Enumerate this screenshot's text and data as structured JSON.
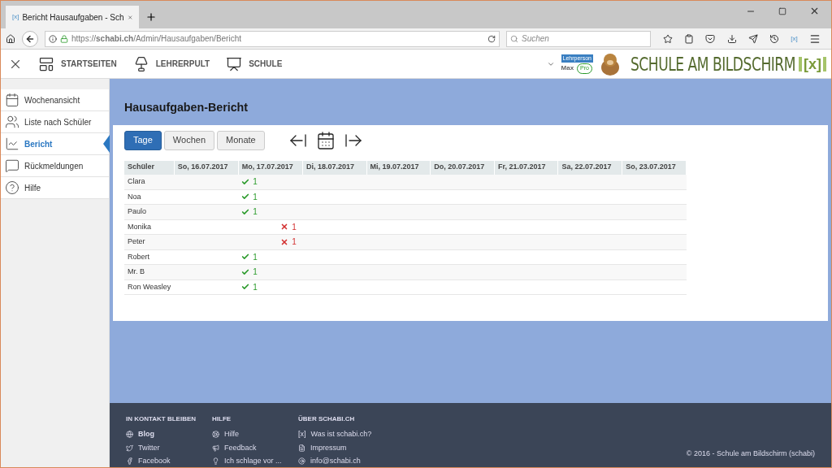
{
  "browser": {
    "favicon": "[x]",
    "tab_title": "Bericht Hausaufgaben - Sch",
    "toolbar_badge": "[x]",
    "url": "https://**schabi.ch**/Admin/Hausaufgaben/Bericht",
    "search_placeholder": "Suchen"
  },
  "topnav": {
    "items": [
      "STARTSEITEN",
      "LEHRERPULT",
      "SCHULE"
    ],
    "user_role": "Lehrperson",
    "user_name": "Max",
    "user_plan": "Pro",
    "logo_text": "SCHULE AM BILDSCHIRM",
    "logo_mark": "[x]"
  },
  "sidebar": {
    "items": [
      {
        "label": "Wochenansicht",
        "selected": false
      },
      {
        "label": "Liste nach Schüler",
        "selected": false
      },
      {
        "label": "Bericht",
        "selected": true
      },
      {
        "label": "Rückmeldungen",
        "selected": false
      },
      {
        "label": "Hilfe",
        "selected": false
      }
    ]
  },
  "page": {
    "title": "Hausaufgaben-Bericht",
    "range_buttons": [
      {
        "label": "Tage",
        "selected": true
      },
      {
        "label": "Wochen",
        "selected": false
      },
      {
        "label": "Monate",
        "selected": false
      }
    ],
    "table": {
      "columns": [
        "Schüler",
        "So, 16.07.2017",
        "Mo, 17.07.2017",
        "Di, 18.07.2017",
        "Mi, 19.07.2017",
        "Do, 20.07.2017",
        "Fr, 21.07.2017",
        "Sa, 22.07.2017",
        "So, 23.07.2017"
      ],
      "rows": [
        {
          "name": "Clara",
          "cells": [
            {
              "kind": "empty"
            },
            {
              "kind": "done",
              "count": "1"
            },
            {
              "kind": "empty"
            },
            {
              "kind": "empty"
            },
            {
              "kind": "empty"
            },
            {
              "kind": "empty"
            },
            {
              "kind": "empty"
            },
            {
              "kind": "empty"
            }
          ]
        },
        {
          "name": "Noa",
          "cells": [
            {
              "kind": "empty"
            },
            {
              "kind": "done",
              "count": "1"
            },
            {
              "kind": "empty"
            },
            {
              "kind": "empty"
            },
            {
              "kind": "empty"
            },
            {
              "kind": "empty"
            },
            {
              "kind": "empty"
            },
            {
              "kind": "empty"
            }
          ]
        },
        {
          "name": "Paulo",
          "cells": [
            {
              "kind": "empty"
            },
            {
              "kind": "done",
              "count": "1"
            },
            {
              "kind": "empty"
            },
            {
              "kind": "empty"
            },
            {
              "kind": "empty"
            },
            {
              "kind": "empty"
            },
            {
              "kind": "empty"
            },
            {
              "kind": "empty"
            }
          ]
        },
        {
          "name": "Monika",
          "cells": [
            {
              "kind": "empty"
            },
            {
              "kind": "missed",
              "count": "1"
            },
            {
              "kind": "empty"
            },
            {
              "kind": "empty"
            },
            {
              "kind": "empty"
            },
            {
              "kind": "empty"
            },
            {
              "kind": "empty"
            },
            {
              "kind": "empty"
            }
          ]
        },
        {
          "name": "Peter",
          "cells": [
            {
              "kind": "empty"
            },
            {
              "kind": "missed",
              "count": "1"
            },
            {
              "kind": "empty"
            },
            {
              "kind": "empty"
            },
            {
              "kind": "empty"
            },
            {
              "kind": "empty"
            },
            {
              "kind": "empty"
            },
            {
              "kind": "empty"
            }
          ]
        },
        {
          "name": "Robert",
          "cells": [
            {
              "kind": "empty"
            },
            {
              "kind": "done",
              "count": "1"
            },
            {
              "kind": "empty"
            },
            {
              "kind": "empty"
            },
            {
              "kind": "empty"
            },
            {
              "kind": "empty"
            },
            {
              "kind": "empty"
            },
            {
              "kind": "empty"
            }
          ]
        },
        {
          "name": "Mr. B",
          "cells": [
            {
              "kind": "empty"
            },
            {
              "kind": "done",
              "count": "1"
            },
            {
              "kind": "empty"
            },
            {
              "kind": "empty"
            },
            {
              "kind": "empty"
            },
            {
              "kind": "empty"
            },
            {
              "kind": "empty"
            },
            {
              "kind": "empty"
            }
          ]
        },
        {
          "name": "Ron Weasley",
          "cells": [
            {
              "kind": "empty"
            },
            {
              "kind": "done",
              "count": "1"
            },
            {
              "kind": "empty"
            },
            {
              "kind": "empty"
            },
            {
              "kind": "empty"
            },
            {
              "kind": "empty"
            },
            {
              "kind": "empty"
            },
            {
              "kind": "empty"
            }
          ]
        }
      ]
    }
  },
  "footer": {
    "columns": [
      {
        "heading": "IN KONTAKT BLEIBEN",
        "links": [
          {
            "label": "Blog",
            "bold": true
          },
          {
            "label": "Twitter",
            "bold": false
          },
          {
            "label": "Facebook",
            "bold": false
          }
        ]
      },
      {
        "heading": "HILFE",
        "links": [
          {
            "label": "Hilfe",
            "bold": false
          },
          {
            "label": "Feedback",
            "bold": false
          },
          {
            "label": "Ich schlage vor ...",
            "bold": false
          }
        ]
      },
      {
        "heading": "ÜBER SCHABI.CH",
        "links": [
          {
            "prefix": "[x]",
            "label": "Was ist schabi.ch?",
            "bold": false
          },
          {
            "label": "Impressum",
            "bold": false
          },
          {
            "label": "info@schabi.ch",
            "bold": false
          }
        ]
      }
    ],
    "copyright": "© 2016 - Schule am Bildschirm (schabi)"
  }
}
